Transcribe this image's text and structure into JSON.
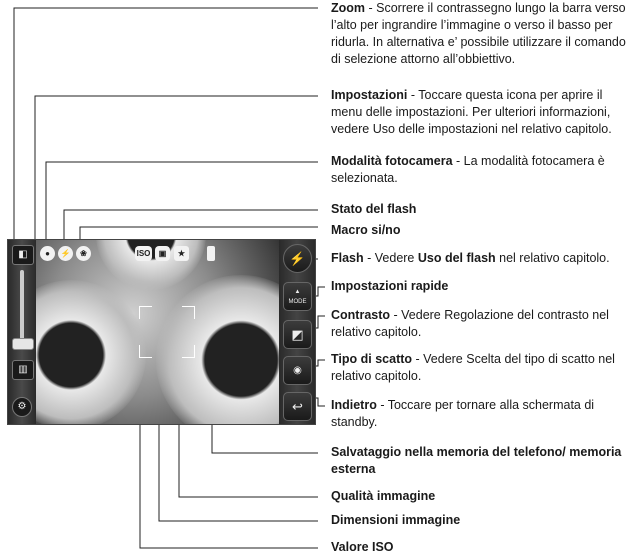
{
  "annotations": [
    {
      "title": "Zoom",
      "text": " - Scorrere il contrassegno lungo la barra verso l’alto per ingrandire l’immagine o verso il basso per ridurla. In alternativa e’ possibile utilizzare il comando di selezione attorno all’obbiettivo."
    },
    {
      "title": "Impostazioni",
      "text": " - Toccare questa icona per aprire il menu delle impostazioni. Per ulteriori informazioni, vedere Uso delle impostazioni nel relativo capitolo."
    },
    {
      "title": "Modalità fotocamera",
      "text": " - La modalità fotocamera è selezionata."
    },
    {
      "title": "Stato del flash",
      "text": ""
    },
    {
      "title": "Macro si/no",
      "text": ""
    },
    {
      "title": "Flash",
      "text": " - Vedere ",
      "title2": "Uso del flash",
      "text2": " nel relativo capitolo."
    },
    {
      "title": "Impostazioni rapide",
      "text": ""
    },
    {
      "title": "Contrasto",
      "text": " - Vedere Regolazione del contrasto nel relativo capitolo."
    },
    {
      "title": "Tipo di scatto",
      "text": " - Vedere Scelta del tipo di scatto nel relativo capitolo."
    },
    {
      "title": "Indietro",
      "text": " - Toccare per tornare alla schermata di standby."
    },
    {
      "title": "Salvataggio nella memoria del telefono/ memoria esterna",
      "text": ""
    },
    {
      "title": "Qualità immagine",
      "text": ""
    },
    {
      "title": "Dimensioni immagine",
      "text": ""
    },
    {
      "title": "Valore ISO",
      "text": ""
    }
  ],
  "screen": {
    "icons": {
      "zoom": "zoom-icon",
      "settings": "gear-icon",
      "camera_mode": "camera-mode-icon",
      "flash_status": "flash-status-icon",
      "macro": "macro-icon",
      "iso": "iso-icon",
      "image_size": "image-size-icon",
      "image_quality": "image-quality-icon",
      "memory": "memory-icon",
      "flash": "flash-icon",
      "mode": "mode-icon",
      "contrast": "contrast-icon",
      "shot_type": "shot-type-icon",
      "back": "back-icon"
    },
    "labels": {
      "iso": "ISO",
      "mode": "MODE"
    }
  }
}
